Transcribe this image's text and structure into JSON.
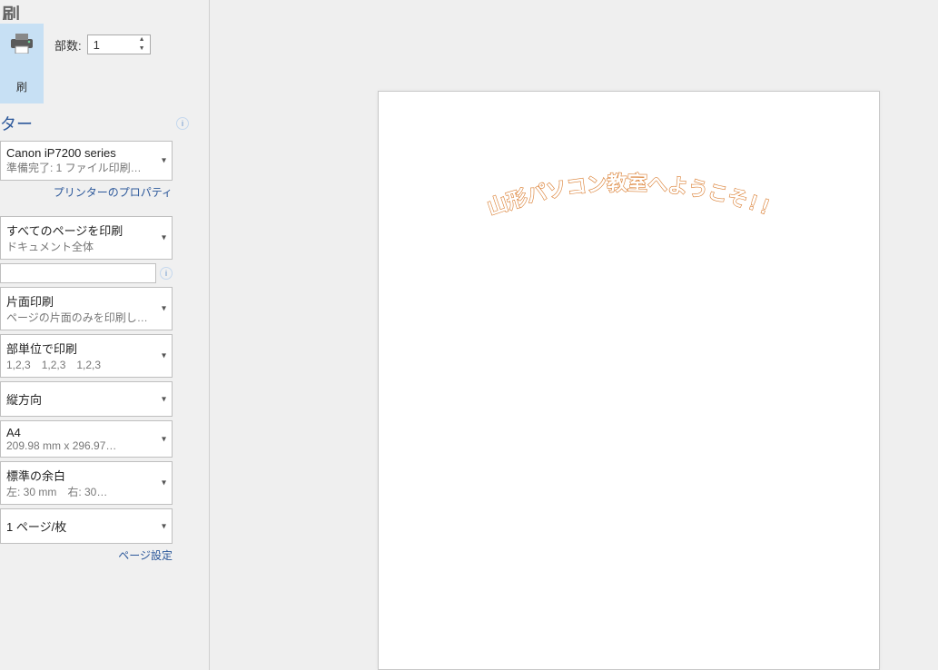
{
  "header": {
    "title_fragment": "刷"
  },
  "print": {
    "button_label": "刷",
    "copies_label": "部数:",
    "copies_value": "1"
  },
  "printer_section": {
    "heading_fragment": "ター",
    "selected_name": "Canon iP7200 series",
    "selected_status": "準備完了: 1 ファイル印刷…",
    "properties_link": "プリンターのプロパティ"
  },
  "settings_section": {
    "pages_title": "すべてのページを印刷",
    "pages_sub": "ドキュメント全体",
    "page_range_value": "",
    "duplex_title": "片面印刷",
    "duplex_sub": "ページの片面のみを印刷し…",
    "collate_title": "部単位で印刷",
    "collate_sub": "1,2,3　1,2,3　1,2,3",
    "orientation_title": "縦方向",
    "paper_title": "A4",
    "paper_sub": "209.98 mm x 296.97…",
    "margins_title": "標準の余白",
    "margins_sub": "左:  30 mm　右:  30…",
    "perpage_title": "1 ページ/枚",
    "page_setup_link": "ページ設定"
  },
  "preview": {
    "wordart_text": "山形パソコン教室へようこそ!!"
  }
}
